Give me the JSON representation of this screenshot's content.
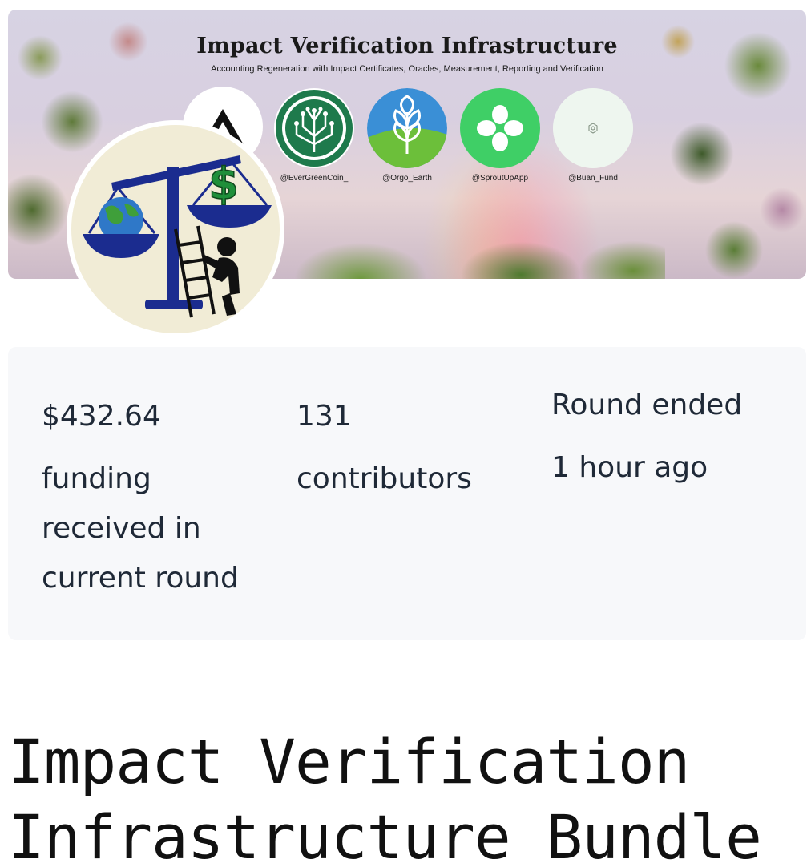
{
  "banner": {
    "title": "Impact Verification Infrastructure",
    "subtitle": "Accounting Regeneration with Impact Certificates, Oracles, Measurement, Reporting and Verification",
    "partners": [
      {
        "handle": "@EverGreenCoin_",
        "icon": "evergreencoin-circuit-tree-logo"
      },
      {
        "handle": "@Orgo_Earth",
        "icon": "orgo-earth-leaf-logo"
      },
      {
        "handle": "@SproutUpApp",
        "icon": "sproutup-clover-logo"
      },
      {
        "handle": "@Buan_Fund",
        "icon": "buan-fund-logo"
      }
    ]
  },
  "avatar": {
    "icon": "balance-scale-earth-dollar-ladder-icon"
  },
  "stats": {
    "funding": {
      "value": "$432.64",
      "label_lines": [
        "funding",
        "received in",
        "current round"
      ]
    },
    "contributors": {
      "value": "131",
      "label": "contributors"
    },
    "round": {
      "status": "Round ended",
      "time": "1 hour ago"
    }
  },
  "project": {
    "title": "Impact Verification Infrastructure Bundle"
  },
  "colors": {
    "card_background": "#f7f8fa",
    "text": "#1f2937",
    "scale_navy": "#1b2c8f",
    "dollar_green": "#1f8f3a"
  }
}
